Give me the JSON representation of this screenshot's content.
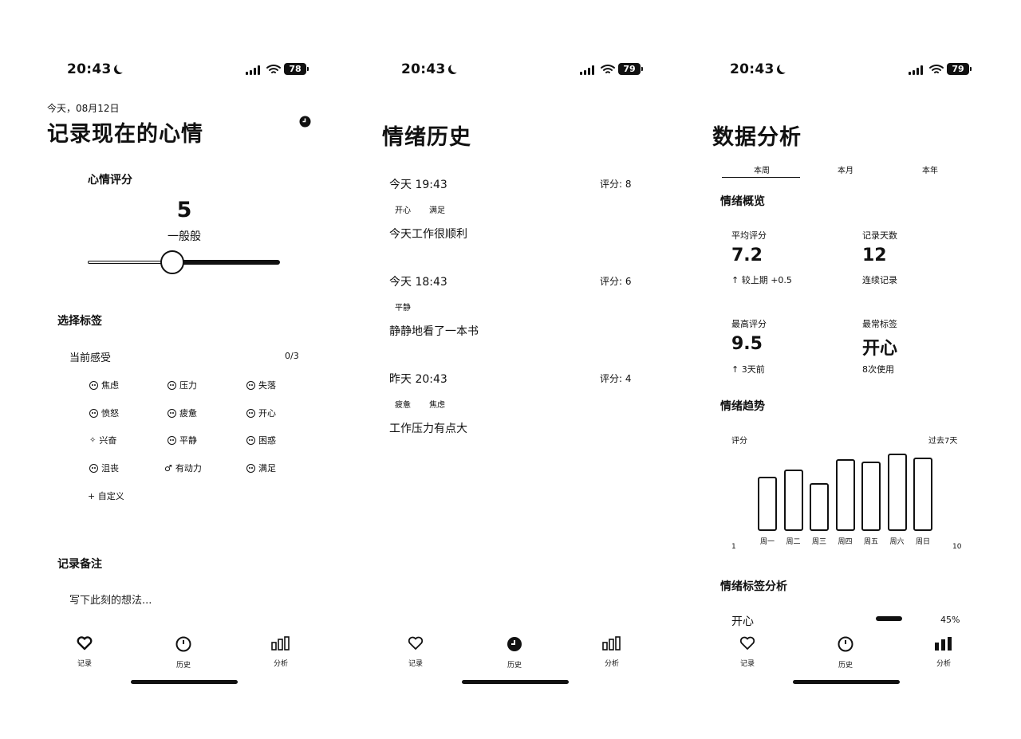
{
  "status": {
    "time": "20:43",
    "battery_1": "78",
    "battery_2": "79",
    "battery_3": "79"
  },
  "tabs": {
    "record": "记录",
    "history": "历史",
    "analysis": "分析"
  },
  "record": {
    "date": "今天，08月12日",
    "title": "记录现在的心情",
    "score_label": "心情评分",
    "score": "5",
    "score_desc": "一般般",
    "score_level": 0.44,
    "tags_heading": "选择标签",
    "feelings_label": "当前感受",
    "feelings_count": "0/3",
    "tags": [
      "焦虑",
      "压力",
      "失落",
      "愤怒",
      "疲惫",
      "开心",
      "兴奋",
      "平静",
      "困惑",
      "沮丧",
      "有动力",
      "满足"
    ],
    "custom": "+ 自定义",
    "note_heading": "记录备注",
    "note_placeholder": "写下此刻的想法..."
  },
  "history": {
    "title": "情绪历史",
    "entries": [
      {
        "time": "今天 19:43",
        "score": "评分: 8",
        "tags": [
          "开心",
          "满足"
        ],
        "note": "今天工作很顺利"
      },
      {
        "time": "今天 18:43",
        "score": "评分: 6",
        "tags": [
          "平静"
        ],
        "note": "静静地看了一本书"
      },
      {
        "time": "昨天 20:43",
        "score": "评分: 4",
        "tags": [
          "疲惫",
          "焦虑"
        ],
        "note": "工作压力有点大"
      }
    ]
  },
  "analysis": {
    "title": "数据分析",
    "segments": [
      "本周",
      "本月",
      "本年"
    ],
    "overview_heading": "情绪概览",
    "avg_label": "平均评分",
    "avg_value": "7.2",
    "avg_note": "↑ 较上期 +0.5",
    "days_label": "记录天数",
    "days_value": "12",
    "days_note": "连续记录",
    "best_label": "最高评分",
    "best_value": "9.5",
    "best_note": "↑ 3天前",
    "common_label": "最常标签",
    "common_value": "开心",
    "common_note": "8次使用",
    "trend_heading": "情绪趋势",
    "tags_heading": "情绪标签分析",
    "tag_row_label": "开心",
    "tag_row_pct": "45%",
    "chart_data": {
      "type": "bar",
      "ylabel": "评分",
      "period_label": "过去7天",
      "axis_min_label": "1",
      "axis_max_label": "10",
      "categories": [
        "周一",
        "周二",
        "周三",
        "周四",
        "周五",
        "周六",
        "周日"
      ],
      "values": [
        6.5,
        7.2,
        5.8,
        8.2,
        8.0,
        8.8,
        8.4
      ],
      "ylim": [
        1,
        10
      ]
    }
  }
}
